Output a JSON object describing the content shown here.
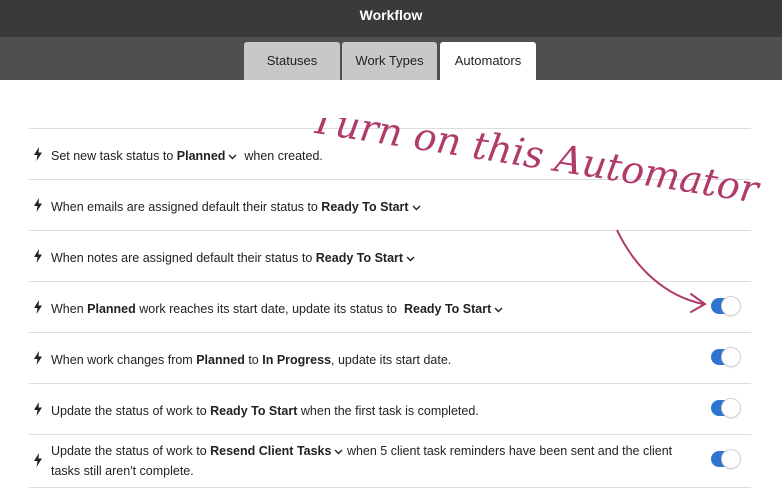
{
  "header": {
    "title": "Workflow"
  },
  "tabs": [
    {
      "label": "Statuses",
      "active": false
    },
    {
      "label": "Work Types",
      "active": false
    },
    {
      "label": "Automators",
      "active": true
    }
  ],
  "rows": [
    {
      "pre": "Set new task status to",
      "dropdown": "Planned",
      "post": "when created."
    },
    {
      "pre": "When emails are assigned default their status to",
      "dropdown": "Ready To Start"
    },
    {
      "pre": "When notes are assigned default their status to",
      "dropdown": "Ready To Start"
    },
    {
      "pre": "When",
      "bold": "Planned",
      "mid": "work reaches its start date, update its status to",
      "dropdown": "Ready To Start",
      "toggle": true
    },
    {
      "pre": "When work changes from",
      "bold1": "Planned",
      "to": "to",
      "bold2": "In Progress",
      "post": ", update its start date.",
      "toggle": true
    },
    {
      "pre": "Update the status of work to",
      "bold": "Ready To Start",
      "post": "when the first task is completed.",
      "toggle": true
    },
    {
      "pre": "Update the status of work to",
      "dropdown": "Resend Client Tasks",
      "post": "when 5 client task reminders have been sent and the client tasks still aren't complete.",
      "toggle": true
    }
  ],
  "annotation": {
    "text": "Turn on this Automator",
    "color": "#b03a6a"
  },
  "colors": {
    "toggle_on": "#2f74d0",
    "topbar": "#3a3a3a",
    "tabbar": "#4f4f4f"
  },
  "icons": {
    "row_icon": "lightning-bolt-icon",
    "dropdown_icon": "chevron-down-icon"
  }
}
